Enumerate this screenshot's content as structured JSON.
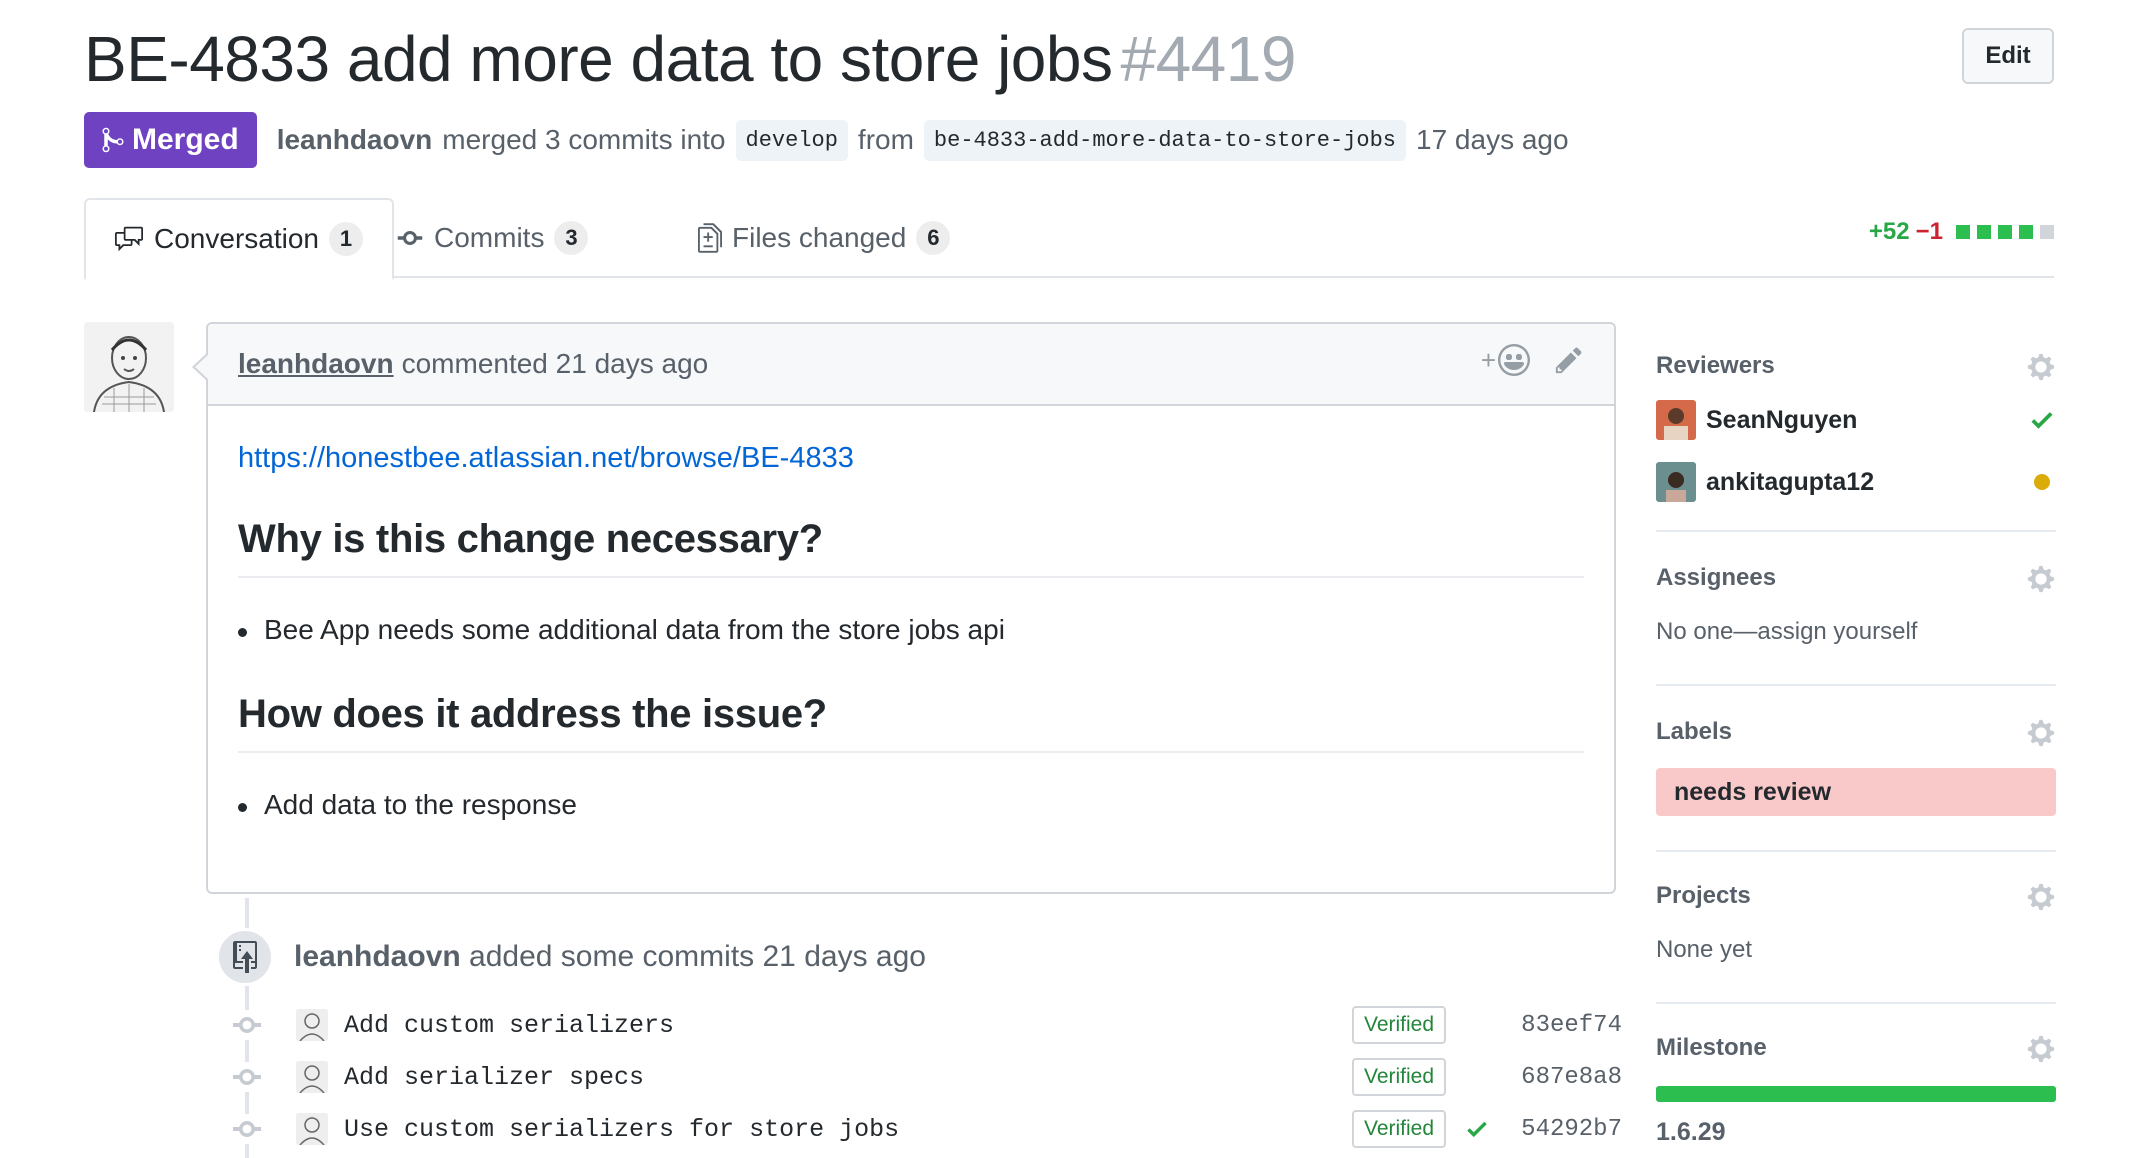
{
  "header": {
    "title": "BE-4833 add more data to store jobs",
    "number": "#4419",
    "edit_label": "Edit"
  },
  "meta": {
    "status": "Merged",
    "author": "leanhdaovn",
    "merged_text": "merged 3 commits into",
    "base_branch": "develop",
    "from_text": "from",
    "head_branch": "be-4833-add-more-data-to-store-jobs",
    "time": "17 days ago"
  },
  "tabs": [
    {
      "label": "Conversation",
      "count": "1",
      "icon": "comment-discussion-icon"
    },
    {
      "label": "Commits",
      "count": "3",
      "icon": "git-commit-icon"
    },
    {
      "label": "Files changed",
      "count": "6",
      "icon": "file-diff-icon"
    }
  ],
  "diffstat": {
    "additions": "+52",
    "deletions": "−1"
  },
  "comment": {
    "author": "leanhdaovn",
    "action": "commented 21 days ago",
    "link": "https://honestbee.atlassian.net/browse/BE-4833",
    "heading1": "Why is this change necessary?",
    "bullet1": "Bee App needs some additional data from the store jobs api",
    "heading2": "How does it address the issue?",
    "bullet2": "Add data to the response",
    "reaction_plus": "+"
  },
  "push_event": {
    "author": "leanhdaovn",
    "text": "added some commits 21 days ago"
  },
  "commits": [
    {
      "message": "Add custom serializers",
      "verified": "Verified",
      "sha": "83eef74"
    },
    {
      "message": "Add serializer specs",
      "verified": "Verified",
      "sha": "687e8a8"
    },
    {
      "message": "Use custom serializers for store jobs",
      "verified": "Verified",
      "sha": "54292b7"
    }
  ],
  "sidebar": {
    "reviewers": {
      "title": "Reviewers",
      "items": [
        {
          "name": "SeanNguyen",
          "status": "approved"
        },
        {
          "name": "ankitagupta12",
          "status": "pending"
        }
      ]
    },
    "assignees": {
      "title": "Assignees",
      "text": "No one—assign yourself"
    },
    "labels": {
      "title": "Labels",
      "items": [
        {
          "name": "needs review",
          "color": "#f9c9c9"
        }
      ]
    },
    "projects": {
      "title": "Projects",
      "text": "None yet"
    },
    "milestone": {
      "title": "Milestone",
      "name": "1.6.29",
      "progress": 1.0
    }
  },
  "colors": {
    "merged": "#6f42c1",
    "link": "#0366d6",
    "green": "#28a745",
    "red": "#cb2431",
    "pending": "#dbab09"
  }
}
